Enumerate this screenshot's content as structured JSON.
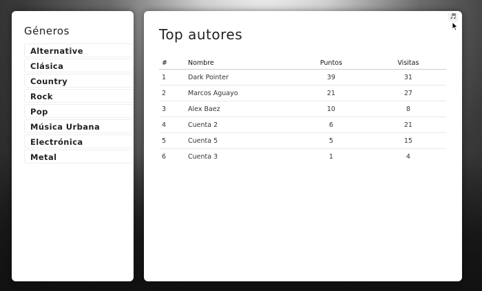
{
  "sidebar": {
    "title": "Géneros",
    "genres": [
      "Alternative",
      "Clásica",
      "Country",
      "Rock",
      "Pop",
      "Música Urbana",
      "Electrónica",
      "Metal"
    ]
  },
  "main": {
    "title": "Top autores",
    "music_icon": "♬",
    "table": {
      "headers": {
        "index": "#",
        "name": "Nombre",
        "points": "Puntos",
        "visits": "Visitas"
      },
      "rows": [
        {
          "index": "1",
          "name": "Dark Pointer",
          "points": "39",
          "visits": "31"
        },
        {
          "index": "2",
          "name": "Marcos Aguayo",
          "points": "21",
          "visits": "27"
        },
        {
          "index": "3",
          "name": "Alex Baez",
          "points": "10",
          "visits": "8"
        },
        {
          "index": "4",
          "name": "Cuenta 2",
          "points": "6",
          "visits": "21"
        },
        {
          "index": "5",
          "name": "Cuenta 5",
          "points": "5",
          "visits": "15"
        },
        {
          "index": "6",
          "name": "Cuenta 3",
          "points": "1",
          "visits": "4"
        }
      ]
    }
  },
  "icons": {
    "music": "music-note-icon",
    "cursor": "mouse-cursor-icon"
  }
}
